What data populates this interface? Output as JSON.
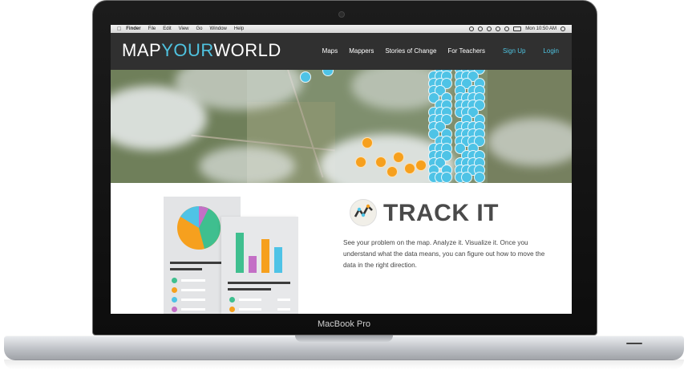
{
  "device": {
    "label": "MacBook Pro"
  },
  "menubar": {
    "apple_glyph": "",
    "items": [
      "Finder",
      "File",
      "Edit",
      "View",
      "Go",
      "Window",
      "Help"
    ],
    "clock": "Mon 10:50 AM"
  },
  "site": {
    "logo": {
      "part1": "MAP",
      "part2": "YOUR",
      "part3": "WORLD"
    },
    "nav": [
      {
        "label": "Maps"
      },
      {
        "label": "Mappers"
      },
      {
        "label": "Stories of Change"
      },
      {
        "label": "For Teachers"
      },
      {
        "label": "Sign Up"
      },
      {
        "label": "Login"
      }
    ]
  },
  "feature": {
    "title": "TRACK IT",
    "description": "See your problem on the map. Analyze it. Visualize it. Once you understand what the data means, you can figure out how to move the data in the right direction."
  },
  "colors": {
    "accent": "#4fc3e0",
    "orange": "#f6a01e",
    "green": "#3fbf8f",
    "purple": "#c46fc6",
    "header": "#303030"
  }
}
